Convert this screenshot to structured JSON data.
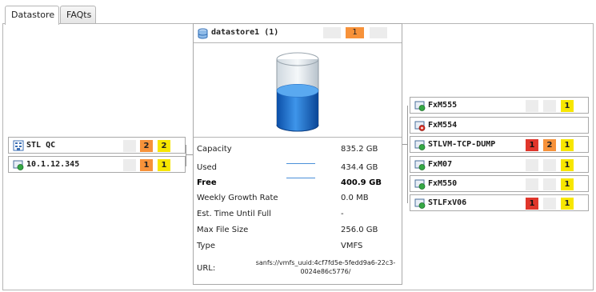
{
  "tabs": [
    {
      "label": "Datastore",
      "active": true
    },
    {
      "label": "FAQts",
      "active": false
    }
  ],
  "datastore": {
    "title": "datastore1 (1)",
    "alarm_counts": [
      "",
      "1",
      ""
    ],
    "properties": [
      {
        "name": "Capacity",
        "value": "835.2 GB",
        "bold": false
      },
      {
        "name": "Used",
        "value": "434.4 GB",
        "bold": false
      },
      {
        "name": "Free",
        "value": "400.9 GB",
        "bold": true
      },
      {
        "name": "Weekly Growth Rate",
        "value": "0.0 MB",
        "bold": false
      },
      {
        "name": "Est. Time Until Full",
        "value": "-",
        "bold": false
      },
      {
        "name": "Max File Size",
        "value": "256.0 GB",
        "bold": false
      },
      {
        "name": "Type",
        "value": "VMFS",
        "bold": false
      }
    ],
    "url_label": "URL:",
    "url_value": "sanfs://vmfs_uuid:4cf7fd5e-5fedd9a6-22c3-0024e86c5776/",
    "fill_fraction": 0.52
  },
  "hosts": [
    {
      "label": "STL QC",
      "icon": "cluster-icon",
      "badges": [
        "",
        "2",
        "2"
      ]
    },
    {
      "label": "10.1.12.345",
      "icon": "host-icon",
      "badges": [
        "",
        "1",
        "1"
      ]
    }
  ],
  "vms": [
    {
      "label": "FxM555",
      "icon": "vm-on-icon",
      "badges": [
        "",
        "",
        "1"
      ]
    },
    {
      "label": "FxM554",
      "icon": "vm-off-icon",
      "badges": []
    },
    {
      "label": "STLVM-TCP-DUMP",
      "icon": "vm-on-icon",
      "badges": [
        "1",
        "2",
        "1"
      ]
    },
    {
      "label": "FxM07",
      "icon": "vm-on-icon",
      "badges": [
        "",
        "",
        "1"
      ]
    },
    {
      "label": "FxM550",
      "icon": "vm-on-icon",
      "badges": [
        "",
        "",
        "1"
      ]
    },
    {
      "label": "STLFxV06",
      "icon": "vm-on-icon",
      "badges": [
        "1",
        "",
        "1"
      ]
    }
  ],
  "colors": {
    "critical": "#e0362b",
    "major": "#f7923a",
    "warning": "#f7e600",
    "empty": "#ececec",
    "cylinder_fill": "#1f6fd1"
  }
}
